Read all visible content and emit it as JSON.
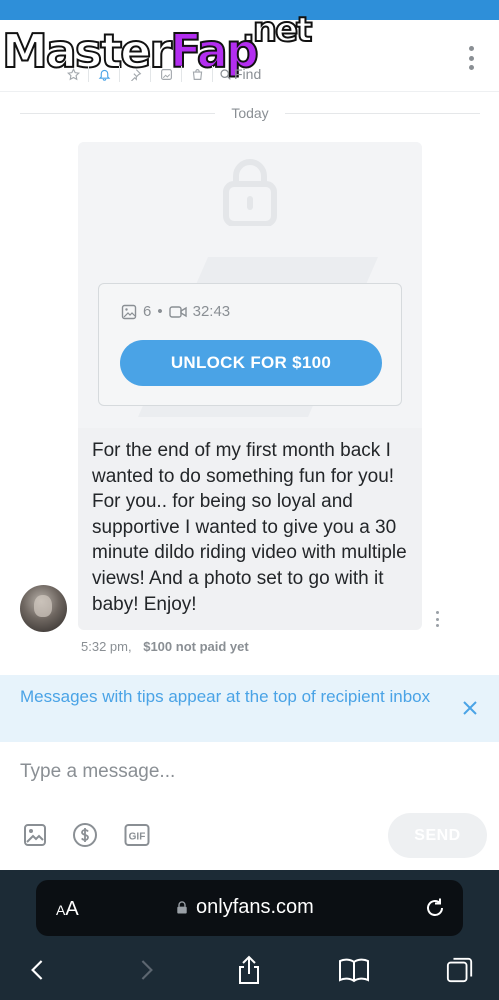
{
  "header": {
    "watermark": {
      "main": "Master",
      "accent": "Fap",
      "suffix": ".net"
    },
    "find_label": "Find",
    "icons": [
      "star-icon",
      "bell-icon",
      "pin-icon",
      "image-icon",
      "bag-icon",
      "search-icon"
    ],
    "accent_color": "#2e8fd9"
  },
  "chat": {
    "date_label": "Today",
    "message": {
      "photo_count": "6",
      "video_duration": "32:43",
      "unlock_label": "UNLOCK FOR $100",
      "text": "For the end of my first month back I wanted to do something fun for you! For you.. for being so loyal and supportive I wanted to give you a 30 minute dildo riding video with multiple views! And a photo set to go with it baby! Enjoy!",
      "time": "5:32 pm,",
      "price_status": "$100 not paid yet"
    }
  },
  "tips_banner": {
    "text": "Messages with tips appear at the top of recipient inbox"
  },
  "composer": {
    "placeholder": "Type a message...",
    "send_label": "SEND"
  },
  "browser": {
    "aa_small": "A",
    "aa_large": "A",
    "url": "onlyfans.com"
  }
}
